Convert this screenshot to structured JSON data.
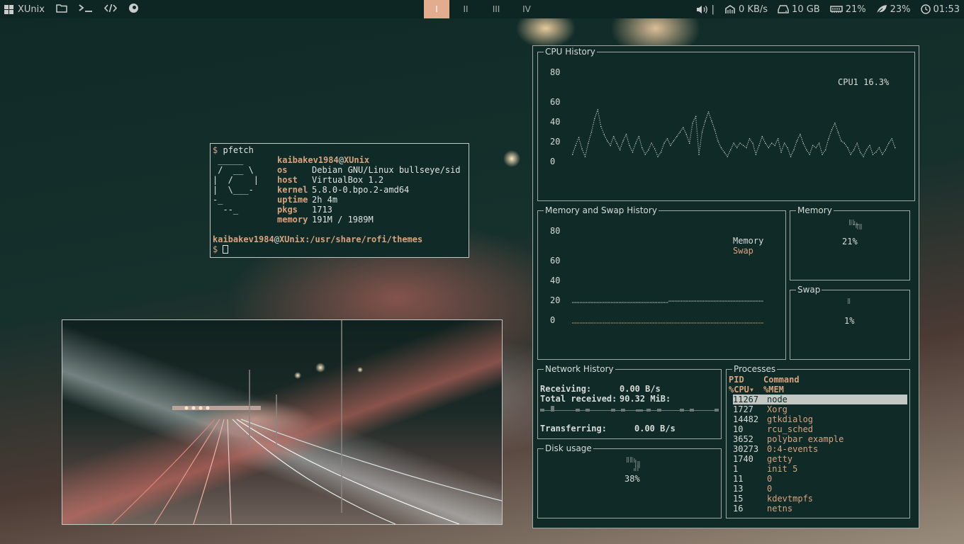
{
  "topbar": {
    "brand": "XUnix",
    "workspaces": [
      {
        "label": "I",
        "active": true
      },
      {
        "label": "II",
        "active": false
      },
      {
        "label": "III",
        "active": false
      },
      {
        "label": "IV",
        "active": false
      }
    ],
    "volume_sep": "|",
    "net": "0 KB/s",
    "disk": "10 GB",
    "mem": "21%",
    "cpu": "23%",
    "clock": "01:53"
  },
  "terminal": {
    "prompt_symbol": "$",
    "command": "pfetch",
    "logo": [
      " _____",
      " /  __ \\",
      "|  /    |",
      "|  \\___-",
      "-_",
      "  --_"
    ],
    "user": "kaibakev1984",
    "at": "@",
    "host": "XUnix",
    "fields": [
      {
        "key": "os",
        "value": "Debian GNU/Linux bullseye/sid"
      },
      {
        "key": "host",
        "value": "VirtualBox 1.2"
      },
      {
        "key": "kernel",
        "value": "5.8.0-0.bpo.2-amd64"
      },
      {
        "key": "uptime",
        "value": "2h 4m"
      },
      {
        "key": "pkgs",
        "value": "1713"
      },
      {
        "key": "memory",
        "value": "191M / 1989M"
      }
    ],
    "prompt_user": "kaibakev1984",
    "prompt_host": "XUnix",
    "prompt_path": ":/usr/share/rofi/themes"
  },
  "conky": {
    "cpu": {
      "title": "CPU History",
      "yticks": [
        "80",
        "60",
        "40",
        "20",
        "0"
      ],
      "legend": "CPU1  16.3%",
      "series": [
        10,
        18,
        25,
        15,
        8,
        20,
        30,
        42,
        50,
        35,
        28,
        22,
        18,
        26,
        20,
        14,
        22,
        28,
        18,
        12,
        20,
        26,
        16,
        10,
        14,
        20,
        15,
        8,
        12,
        20,
        24,
        18,
        22,
        26,
        30,
        34,
        28,
        20,
        38,
        44,
        10,
        30,
        40,
        48,
        40,
        32,
        22,
        16,
        12,
        8,
        14,
        20,
        16,
        20,
        18,
        16,
        24,
        20,
        10,
        18,
        26,
        20,
        16,
        20,
        18,
        24,
        12,
        20,
        16,
        8,
        14,
        22,
        28,
        20,
        14,
        10,
        18,
        16,
        20,
        10,
        14,
        24,
        32,
        38,
        30,
        22,
        20,
        16,
        10,
        14,
        20,
        12,
        8,
        14,
        18,
        10,
        12,
        16,
        10,
        14,
        20,
        24,
        16
      ]
    },
    "mem": {
      "title": "Memory and Swap History",
      "yticks": [
        "80",
        "60",
        "40",
        "20",
        "0"
      ],
      "legend_mem": "Memory",
      "legend_swap": "Swap",
      "memory_level": 20,
      "swap_level": 1
    },
    "memory": {
      "title": "Memory",
      "value": "21%"
    },
    "swap": {
      "title": "Swap",
      "value": "1%"
    },
    "network": {
      "title": "Network History",
      "receiving_label": "Receiving:",
      "receiving_value": "0.00 B/s",
      "total_label": "Total received:",
      "total_value": "90.32 MiB:",
      "transferring_label": "Transferring:",
      "transferring_value": "0.00 B/s"
    },
    "disk": {
      "title": "Disk usage",
      "value": "38%"
    },
    "processes": {
      "title": "Processes",
      "col1": "PID",
      "col2": "Command",
      "col3": "%CPU▾",
      "col4": "%MEM",
      "rows": [
        {
          "pid": "11267",
          "cmd": "node"
        },
        {
          "pid": "1727",
          "cmd": "Xorg"
        },
        {
          "pid": "14482",
          "cmd": "gtkdialog"
        },
        {
          "pid": "10",
          "cmd": "rcu_sched"
        },
        {
          "pid": "3652",
          "cmd": "polybar example"
        },
        {
          "pid": "30273",
          "cmd": "0:4-events"
        },
        {
          "pid": "1740",
          "cmd": "getty"
        },
        {
          "pid": "1",
          "cmd": "init 5"
        },
        {
          "pid": "11",
          "cmd": "0"
        },
        {
          "pid": "13",
          "cmd": "0"
        },
        {
          "pid": "15",
          "cmd": "kdevtmpfs"
        },
        {
          "pid": "16",
          "cmd": "netns"
        }
      ]
    }
  }
}
